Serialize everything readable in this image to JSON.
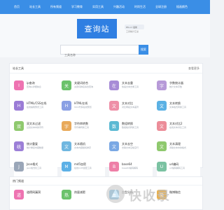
{
  "top_nav": [
    {
      "label": "首页"
    },
    {
      "label": "站长工具"
    },
    {
      "label": "所有频道"
    },
    {
      "label": "学习教育"
    },
    {
      "label": "实用工具"
    },
    {
      "label": "兴趣活动"
    },
    {
      "label": "时尚生活"
    },
    {
      "label": "全球注册"
    },
    {
      "label": "插画颜色"
    }
  ],
  "hero": {
    "logo_text": "查询站",
    "meta_line1": "tifu.cc 最新",
    "meta_line2": "工具统计汇总"
  },
  "search": {
    "placeholder": "工具名称",
    "button_label": "搜索"
  },
  "section1": {
    "title": "站长工具",
    "more": "查看更多",
    "tools": [
      {
        "badge": "I",
        "name": "ip查询",
        "desc": "查询ip详细信息",
        "color": "#ee73b1"
      },
      {
        "badge": "关",
        "name": "关键词综合",
        "desc": "关键词排名综合查询",
        "color": "#6bc26b"
      },
      {
        "badge": "在",
        "name": "文本去重",
        "desc": "快速文本去重工具",
        "color": "#a78bd6"
      },
      {
        "badge": "字",
        "name": "字数统计器",
        "desc": "统计文本字数",
        "color": "#b79ad8"
      },
      {
        "badge": "H",
        "name": "HTML/CSS在线",
        "desc": "在线编辑预览工具",
        "color": "#9b7cd6"
      },
      {
        "badge": "H",
        "name": "HTML在线",
        "desc": "html代码在线预览",
        "color": "#8aa0e4"
      },
      {
        "badge": "文",
        "name": "文本对比",
        "desc": "对比两段文本差异",
        "color": "#ee8fa7"
      },
      {
        "badge": "文",
        "name": "文本转换",
        "desc": "文本格式转换工具",
        "color": "#5bb1e4"
      },
      {
        "badge": "双",
        "name": "双文本过滤",
        "desc": "过滤文本中的字符",
        "color": "#8fc96e"
      },
      {
        "badge": "字",
        "name": "字符串转数",
        "desc": "字符串转换工具",
        "color": "#e8a95a"
      },
      {
        "badge": "数",
        "name": "数组转换",
        "desc": "数组格式转换工具",
        "color": "#5cb9d3"
      },
      {
        "badge": "文",
        "name": "文本对比2",
        "desc": "在线文本对比工具",
        "color": "#ec8d99"
      },
      {
        "badge": "统",
        "name": "统计重复",
        "desc": "统计重复内容数量",
        "color": "#9c7fd7"
      },
      {
        "badge": "文",
        "name": "文本随机",
        "desc": "文本内容随机排序",
        "color": "#70b7e0"
      },
      {
        "badge": "文",
        "name": "文本去空",
        "desc": "去除文本空格空行",
        "color": "#7aa8e4"
      },
      {
        "badge": "文",
        "name": "文本清理",
        "desc": "清除文本中的格式",
        "color": "#8fc96e"
      },
      {
        "badge": "J",
        "name": "Json格式",
        "desc": "json格式化工具",
        "color": "#9aa6b8"
      },
      {
        "badge": "M",
        "name": "md5加密",
        "desc": "在线md5加密工具",
        "color": "#5cb0e6"
      },
      {
        "badge": "B",
        "name": "base64",
        "desc": "base64编码解码",
        "color": "#ee7fa7"
      },
      {
        "badge": "U",
        "name": "url编码",
        "desc": "url编码解码工具",
        "color": "#7bc2a2"
      }
    ]
  },
  "section2": {
    "title": "热门频道",
    "more": "",
    "tools": [
      {
        "badge": "道",
        "name": "道德网漏洞",
        "desc": "",
        "color": "#ee73b1"
      },
      {
        "badge": "热",
        "name": "热量减肥",
        "desc": "",
        "color": "#6bc26b"
      },
      {
        "badge": "血",
        "name": "血型分析",
        "desc": "",
        "color": "#5bb1e4"
      },
      {
        "badge": "微",
        "name": "微博微信",
        "desc": "",
        "color": "#e8b04f"
      }
    ]
  },
  "watermark": {
    "text": "快收录"
  }
}
